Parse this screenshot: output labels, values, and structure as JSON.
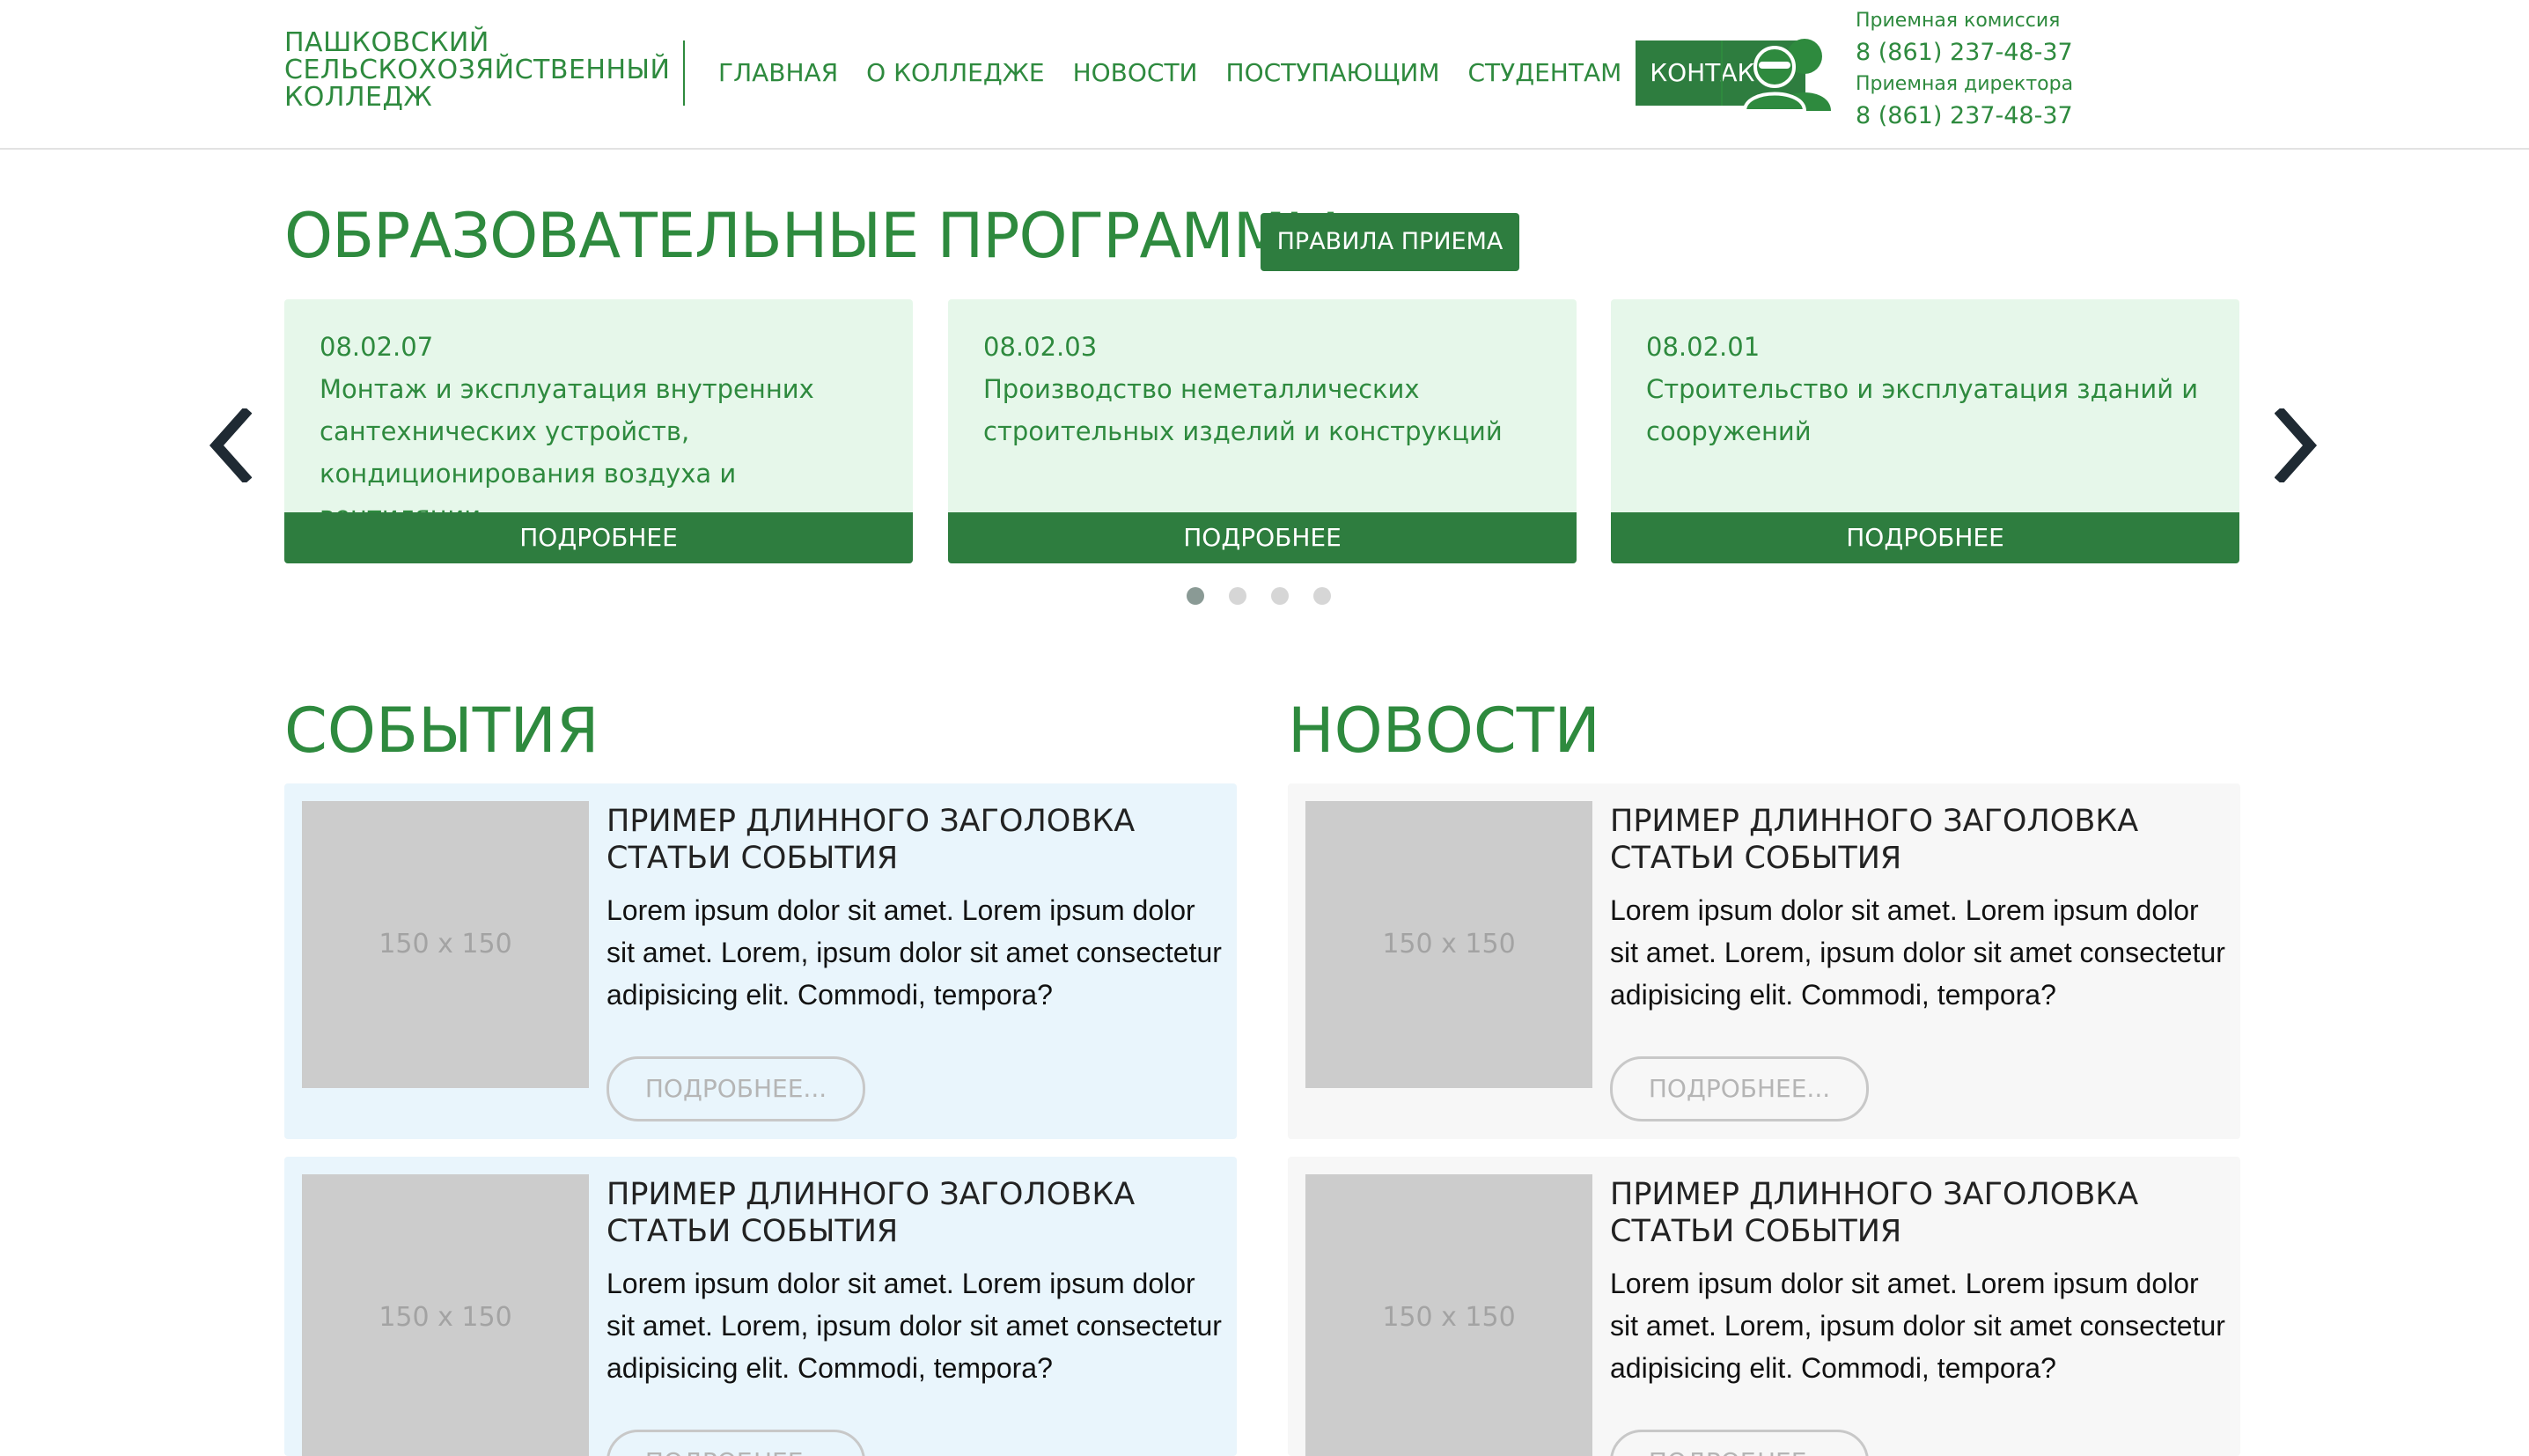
{
  "header": {
    "logo_lines": [
      "ПАШКОВСКИЙ",
      "СЕЛЬСКОХОЗЯЙСТВЕННЫЙ",
      "КОЛЛЕДЖ"
    ],
    "nav": [
      {
        "label": "ГЛАВНАЯ"
      },
      {
        "label": "О КОЛЛЕДЖЕ"
      },
      {
        "label": "НОВОСТИ"
      },
      {
        "label": "ПОСТУПАЮЩИМ"
      },
      {
        "label": "СТУДЕНТАМ"
      },
      {
        "label": "КОНТАКТЫ",
        "active": true
      }
    ],
    "contacts": {
      "icon": "users-icon",
      "admission_label": "Приемная комиссия",
      "admission_phone": "8 (861) 237-48-37",
      "director_label": "Приемная директора",
      "director_phone": "8 (861) 237-48-37"
    }
  },
  "programs": {
    "title": "ОБРАЗОВАТЕЛЬНЫЕ ПРОГРАММЫ",
    "rules_button": "ПРАВИЛА ПРИЕМА",
    "prev_icon": "chevron-left-icon",
    "next_icon": "chevron-right-icon",
    "cards": [
      {
        "code": "08.02.07",
        "name": "Монтаж и эксплуатация внутренних сантехнических устройств, кондиционирования воздуха и вентиляции",
        "more": "ПОДРОБНЕЕ"
      },
      {
        "code": "08.02.03",
        "name": "Производство неметаллических строительных изделий и конструкций",
        "more": "ПОДРОБНЕЕ"
      },
      {
        "code": "08.02.01",
        "name": "Строительство и эксплуатация зданий и сооружений",
        "more": "ПОДРОБНЕЕ"
      }
    ],
    "dots_count": 4,
    "active_dot": 1
  },
  "events": {
    "title": "СОБЫТИЯ",
    "items": [
      {
        "thumb": "150 x 150",
        "title": "ПРИМЕР ДЛИННОГО ЗАГОЛОВКА СТАТЬИ СОБЫТИЯ",
        "text": "Lorem ipsum dolor sit amet. Lorem ipsum dolor sit amet. Lorem, ipsum dolor sit amet consectetur adipisicing elit. Commodi, tempora?",
        "more": "ПОДРОБНЕЕ..."
      },
      {
        "thumb": "150 x 150",
        "title": "ПРИМЕР ДЛИННОГО ЗАГОЛОВКА СТАТЬИ СОБЫТИЯ",
        "text": "Lorem ipsum dolor sit amet. Lorem ipsum dolor sit amet. Lorem, ipsum dolor sit amet consectetur adipisicing elit. Commodi, tempora?",
        "more": "ПОДРОБНЕЕ..."
      }
    ]
  },
  "news": {
    "title": "НОВОСТИ",
    "items": [
      {
        "thumb": "150 x 150",
        "title": "ПРИМЕР ДЛИННОГО ЗАГОЛОВКА СТАТЬИ СОБЫТИЯ",
        "text": "Lorem ipsum dolor sit amet. Lorem ipsum dolor sit amet. Lorem, ipsum dolor sit amet consectetur adipisicing elit. Commodi, tempora?",
        "more": "ПОДРОБНЕЕ..."
      },
      {
        "thumb": "150 x 150",
        "title": "ПРИМЕР ДЛИННОГО ЗАГОЛОВКА СТАТЬИ СОБЫТИЯ",
        "text": "Lorem ipsum dolor sit amet. Lorem ipsum dolor sit amet. Lorem, ipsum dolor sit amet consectetur adipisicing elit. Commodi, tempora?",
        "more": "ПОДРОБНЕЕ..."
      }
    ]
  },
  "colors": {
    "brand_green": "#2e7d3f",
    "text_green": "#2e8a3e",
    "card_bg": "#e6f7ea",
    "event_bg": "#e9f5fc",
    "news_bg": "#f7f7f7"
  }
}
